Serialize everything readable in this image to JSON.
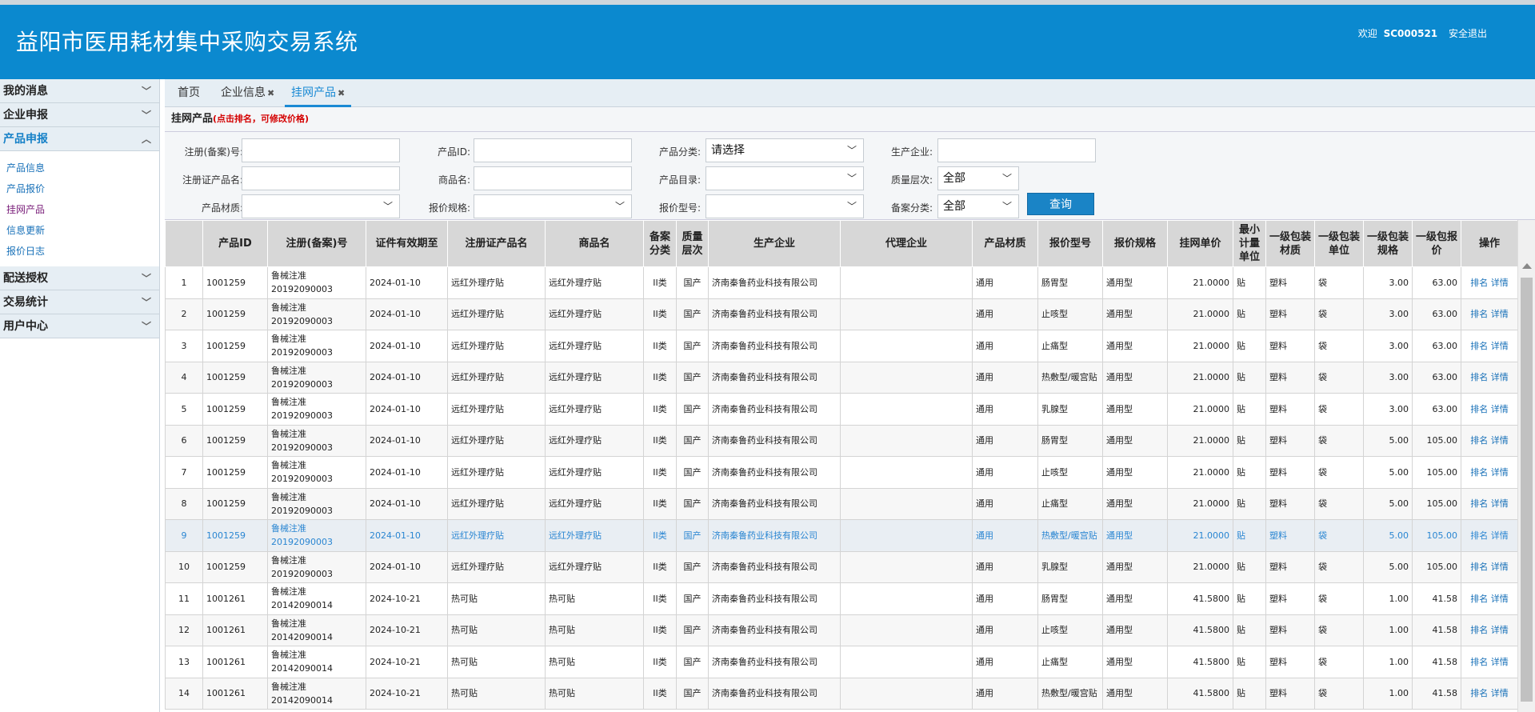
{
  "app": {
    "title": "益阳市医用耗材集中采购交易系统",
    "welcome": "欢迎",
    "user": "SC000521",
    "logout": "安全退出"
  },
  "sidebar": {
    "groups": [
      {
        "label": "我的消息",
        "open": false
      },
      {
        "label": "企业申报",
        "open": false
      },
      {
        "label": "产品申报",
        "open": true,
        "items": [
          "产品信息",
          "产品报价",
          "挂网产品",
          "信息更新",
          "报价日志"
        ]
      },
      {
        "label": "配送授权",
        "open": false
      },
      {
        "label": "交易统计",
        "open": false
      },
      {
        "label": "用户中心",
        "open": false
      }
    ]
  },
  "tabs": [
    "首页",
    "企业信息",
    "挂网产品"
  ],
  "crumb": {
    "title": "挂网产品",
    "note": "(点击排名，可修改价格)"
  },
  "filters": {
    "reg_no": "注册(备案)号:",
    "product_id": "产品ID:",
    "category": "产品分类:",
    "category_value": "请选择",
    "manufacturer": "生产企业:",
    "cert_name": "注册证产品名:",
    "trade_name": "商品名:",
    "catalog": "产品目录:",
    "quality": "质量层次:",
    "quality_value": "全部",
    "material": "产品材质:",
    "spec": "报价规格:",
    "model": "报价型号:",
    "filing": "备案分类:",
    "filing_value": "全部",
    "query": "查询"
  },
  "table": {
    "headers": [
      "",
      "产品ID",
      "注册(备案)号",
      "证件有效期至",
      "注册证产品名",
      "商品名",
      "备案分类",
      "质量层次",
      "生产企业",
      "代理企业",
      "产品材质",
      "报价型号",
      "报价规格",
      "挂网单价",
      "最小计量单位",
      "一级包装材质",
      "一级包装单位",
      "一级包装规格",
      "一级包报价",
      "操作"
    ],
    "ops": [
      "排名",
      "详情"
    ],
    "rows": [
      [
        "1",
        "1001259",
        "鲁械注准20192090003",
        "2024-01-10",
        "远红外理疗贴",
        "远红外理疗贴",
        "II类",
        "国产",
        "济南秦鲁药业科技有限公司",
        "",
        "通用",
        "肠胃型",
        "通用型",
        "21.0000",
        "贴",
        "塑料",
        "袋",
        "3.00",
        "63.00"
      ],
      [
        "2",
        "1001259",
        "鲁械注准20192090003",
        "2024-01-10",
        "远红外理疗贴",
        "远红外理疗贴",
        "II类",
        "国产",
        "济南秦鲁药业科技有限公司",
        "",
        "通用",
        "止咳型",
        "通用型",
        "21.0000",
        "贴",
        "塑料",
        "袋",
        "3.00",
        "63.00"
      ],
      [
        "3",
        "1001259",
        "鲁械注准20192090003",
        "2024-01-10",
        "远红外理疗贴",
        "远红外理疗贴",
        "II类",
        "国产",
        "济南秦鲁药业科技有限公司",
        "",
        "通用",
        "止痛型",
        "通用型",
        "21.0000",
        "贴",
        "塑料",
        "袋",
        "3.00",
        "63.00"
      ],
      [
        "4",
        "1001259",
        "鲁械注准20192090003",
        "2024-01-10",
        "远红外理疗贴",
        "远红外理疗贴",
        "II类",
        "国产",
        "济南秦鲁药业科技有限公司",
        "",
        "通用",
        "热敷型/暖宫贴",
        "通用型",
        "21.0000",
        "贴",
        "塑料",
        "袋",
        "3.00",
        "63.00"
      ],
      [
        "5",
        "1001259",
        "鲁械注准20192090003",
        "2024-01-10",
        "远红外理疗贴",
        "远红外理疗贴",
        "II类",
        "国产",
        "济南秦鲁药业科技有限公司",
        "",
        "通用",
        "乳腺型",
        "通用型",
        "21.0000",
        "贴",
        "塑料",
        "袋",
        "3.00",
        "63.00"
      ],
      [
        "6",
        "1001259",
        "鲁械注准20192090003",
        "2024-01-10",
        "远红外理疗贴",
        "远红外理疗贴",
        "II类",
        "国产",
        "济南秦鲁药业科技有限公司",
        "",
        "通用",
        "肠胃型",
        "通用型",
        "21.0000",
        "贴",
        "塑料",
        "袋",
        "5.00",
        "105.00"
      ],
      [
        "7",
        "1001259",
        "鲁械注准20192090003",
        "2024-01-10",
        "远红外理疗贴",
        "远红外理疗贴",
        "II类",
        "国产",
        "济南秦鲁药业科技有限公司",
        "",
        "通用",
        "止咳型",
        "通用型",
        "21.0000",
        "贴",
        "塑料",
        "袋",
        "5.00",
        "105.00"
      ],
      [
        "8",
        "1001259",
        "鲁械注准20192090003",
        "2024-01-10",
        "远红外理疗贴",
        "远红外理疗贴",
        "II类",
        "国产",
        "济南秦鲁药业科技有限公司",
        "",
        "通用",
        "止痛型",
        "通用型",
        "21.0000",
        "贴",
        "塑料",
        "袋",
        "5.00",
        "105.00"
      ],
      [
        "9",
        "1001259",
        "鲁械注准20192090003",
        "2024-01-10",
        "远红外理疗贴",
        "远红外理疗贴",
        "II类",
        "国产",
        "济南秦鲁药业科技有限公司",
        "",
        "通用",
        "热敷型/暖宫贴",
        "通用型",
        "21.0000",
        "贴",
        "塑料",
        "袋",
        "5.00",
        "105.00"
      ],
      [
        "10",
        "1001259",
        "鲁械注准20192090003",
        "2024-01-10",
        "远红外理疗贴",
        "远红外理疗贴",
        "II类",
        "国产",
        "济南秦鲁药业科技有限公司",
        "",
        "通用",
        "乳腺型",
        "通用型",
        "21.0000",
        "贴",
        "塑料",
        "袋",
        "5.00",
        "105.00"
      ],
      [
        "11",
        "1001261",
        "鲁械注准20142090014",
        "2024-10-21",
        "热可贴",
        "热可贴",
        "II类",
        "国产",
        "济南秦鲁药业科技有限公司",
        "",
        "通用",
        "肠胃型",
        "通用型",
        "41.5800",
        "贴",
        "塑料",
        "袋",
        "1.00",
        "41.58"
      ],
      [
        "12",
        "1001261",
        "鲁械注准20142090014",
        "2024-10-21",
        "热可贴",
        "热可贴",
        "II类",
        "国产",
        "济南秦鲁药业科技有限公司",
        "",
        "通用",
        "止咳型",
        "通用型",
        "41.5800",
        "贴",
        "塑料",
        "袋",
        "1.00",
        "41.58"
      ],
      [
        "13",
        "1001261",
        "鲁械注准20142090014",
        "2024-10-21",
        "热可贴",
        "热可贴",
        "II类",
        "国产",
        "济南秦鲁药业科技有限公司",
        "",
        "通用",
        "止痛型",
        "通用型",
        "41.5800",
        "贴",
        "塑料",
        "袋",
        "1.00",
        "41.58"
      ],
      [
        "14",
        "1001261",
        "鲁械注准20142090014",
        "2024-10-21",
        "热可贴",
        "热可贴",
        "II类",
        "国产",
        "济南秦鲁药业科技有限公司",
        "",
        "通用",
        "热敷型/暖宫贴",
        "通用型",
        "41.5800",
        "贴",
        "塑料",
        "袋",
        "1.00",
        "41.58"
      ]
    ],
    "highlight_row": 9
  }
}
